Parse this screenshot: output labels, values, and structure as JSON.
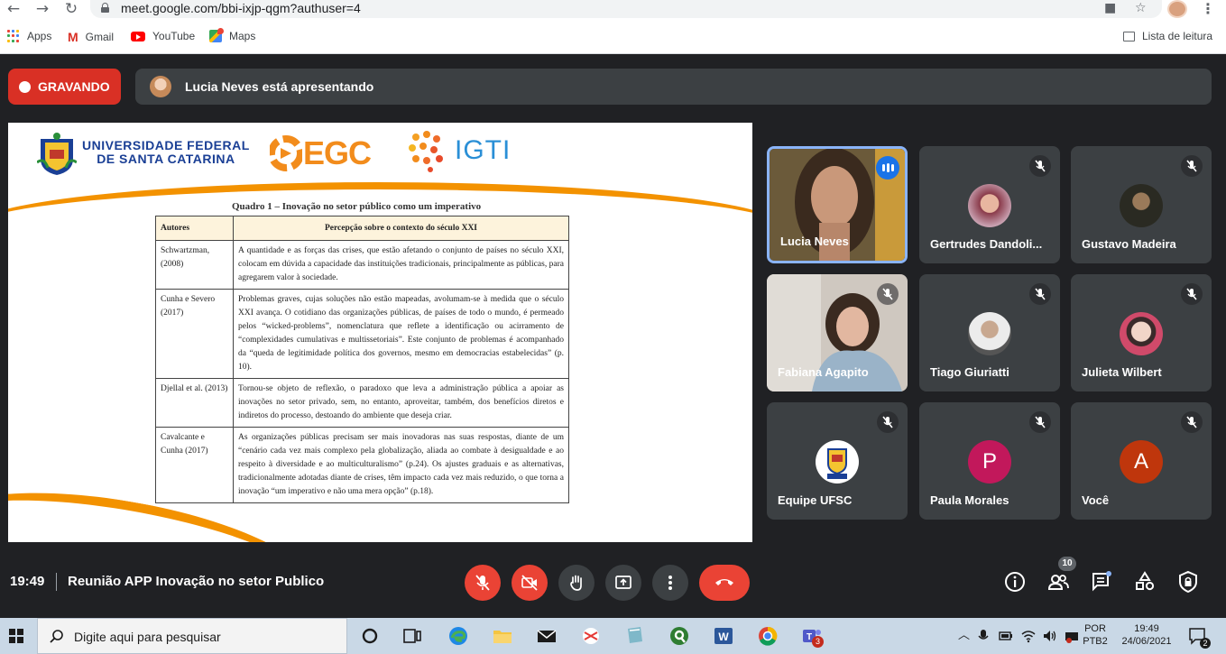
{
  "browser": {
    "url": "meet.google.com/bbi-ixjp-qgm?authuser=4",
    "bookmarks": [
      {
        "label": "Apps",
        "icon": "apps-grid-icon"
      },
      {
        "label": "Gmail",
        "icon": "gmail-icon"
      },
      {
        "label": "YouTube",
        "icon": "youtube-icon"
      },
      {
        "label": "Maps",
        "icon": "maps-icon"
      }
    ],
    "reading_list": "Lista de leitura"
  },
  "meet": {
    "recording_label": "GRAVANDO",
    "presenting_text": "Lucia Neves está apresentando",
    "time": "19:49",
    "meeting_name": "Reunião APP Inovação no setor Publico",
    "participants_count": "10",
    "accent_red": "#ea4335"
  },
  "slide": {
    "logo_ufsc": "UNIVERSIDADE FEDERAL\nDE SANTA CATARINA",
    "logo_egc": "EGC",
    "logo_igti": "IGTI",
    "quadro_title": "Quadro 1 – Inovação no setor público como um imperativo",
    "table_headers": [
      "Autores",
      "Percepção sobre o contexto do século XXI"
    ],
    "table_rows": [
      {
        "author": "Schwartzman, (2008)",
        "text": "A quantidade e as forças das crises, que estão afetando o conjunto de países no século XXI, colocam em dúvida a capacidade das instituições tradicionais, principalmente as públicas, para agregarem valor à sociedade."
      },
      {
        "author": "Cunha e Severo (2017)",
        "text": "Problemas graves, cujas soluções não estão mapeadas, avolumam-se à medida que o século XXI avança. O cotidiano das organizações públicas, de países de todo o mundo, é permeado pelos “wicked-problems”, nomenclatura que reflete a identificação ou acirramento de “complexidades cumulativas e multissetoriais”. Este conjunto de problemas é acompanhado da “queda de legitimidade política dos governos, mesmo em democracias estabelecidas” (p. 10)."
      },
      {
        "author": "Djellal et al. (2013)",
        "text": "Tornou-se objeto de reflexão, o paradoxo que leva a administração pública a apoiar as inovações no setor privado, sem, no entanto, aproveitar, também, dos benefícios diretos e indiretos do processo, destoando do ambiente que deseja criar."
      },
      {
        "author": "Cavalcante e Cunha (2017)",
        "text": "As organizações públicas precisam ser mais inovadoras nas suas respostas, diante de um “cenário cada vez mais complexo pela globalização, aliada ao combate à desigualdade e ao respeito à diversidade e ao multiculturalismo” (p.24). Os ajustes graduais e as alternativas, tradicionalmente adotadas diante de crises, têm impacto cada vez mais reduzido, o que torna a inovação “um imperativo e não uma mera opção” (p.18)."
      }
    ]
  },
  "participants": [
    {
      "name": "Lucia Neves",
      "type": "video-lucia",
      "speaking": true
    },
    {
      "name": "Gertrudes Dandoli...",
      "type": "photo",
      "color": "#8a4a5a"
    },
    {
      "name": "Gustavo Madeira",
      "type": "photo",
      "color": "#3a3a30"
    },
    {
      "name": "Fabiana Agapito",
      "type": "video-fabiana"
    },
    {
      "name": "Tiago Giuriatti",
      "type": "photo",
      "color": "#9a9a9a"
    },
    {
      "name": "Julieta Wilbert",
      "type": "photo",
      "color": "#c64a6a"
    },
    {
      "name": "Equipe UFSC",
      "type": "logo",
      "color": "#ffffff"
    },
    {
      "name": "Paula Morales",
      "type": "letter",
      "letter": "P",
      "color": "#c2185b"
    },
    {
      "name": "Você",
      "type": "letter",
      "letter": "A",
      "color": "#bf360c"
    }
  ],
  "taskbar": {
    "search_placeholder": "Digite aqui para pesquisar",
    "lang_line1": "POR",
    "lang_line2": "PTB2",
    "clock_time": "19:49",
    "clock_date": "24/06/2021",
    "teams_badge": "3",
    "notif_badge": "2"
  }
}
